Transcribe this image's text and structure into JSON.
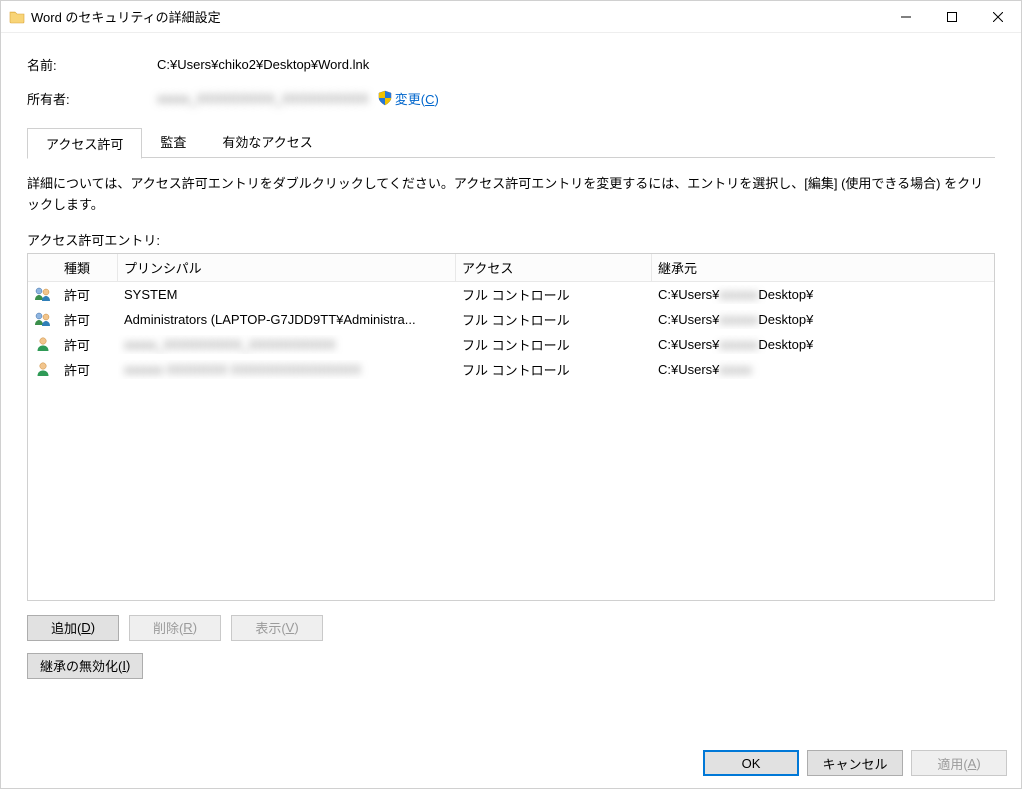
{
  "window": {
    "title": "Word のセキュリティの詳細設定"
  },
  "header": {
    "name_label": "名前:",
    "name_value": "C:¥Users¥chiko2¥Desktop¥Word.lnk",
    "owner_label": "所有者:",
    "owner_value": "xxxxx_XXXXXXXXX_XXXXXXXXXX",
    "change_link_prefix": "変更(",
    "change_link_hotkey": "C",
    "change_link_suffix": ")"
  },
  "tabs": {
    "items": [
      {
        "label": "アクセス許可",
        "active": true
      },
      {
        "label": "監査",
        "active": false
      },
      {
        "label": "有効なアクセス",
        "active": false
      }
    ]
  },
  "body": {
    "description": "詳細については、アクセス許可エントリをダブルクリックしてください。アクセス許可エントリを変更するには、エントリを選択し、[編集] (使用できる場合) をクリックします。",
    "entries_label": "アクセス許可エントリ:"
  },
  "table": {
    "columns": {
      "type": "種類",
      "principal": "プリンシパル",
      "access": "アクセス",
      "inherited": "継承元"
    },
    "rows": [
      {
        "icon": "group",
        "type": "許可",
        "principal": "SYSTEM",
        "principal_blurred": false,
        "access": "フル コントロール",
        "inherited": "C:¥Users¥",
        "inherited_mid_blur": "xxxxxx",
        "inherited_suffix": "Desktop¥"
      },
      {
        "icon": "group",
        "type": "許可",
        "principal": "Administrators (LAPTOP-G7JDD9TT¥Administra...",
        "principal_blurred": false,
        "access": "フル コントロール",
        "inherited": "C:¥Users¥",
        "inherited_mid_blur": "xxxxxx",
        "inherited_suffix": "Desktop¥"
      },
      {
        "icon": "user",
        "type": "許可",
        "principal": "xxxxx_XXXXXXXXX_XXXXXXXXXX",
        "principal_blurred": true,
        "access": "フル コントロール",
        "inherited": "C:¥Users¥",
        "inherited_mid_blur": "xxxxxx",
        "inherited_suffix": "Desktop¥"
      },
      {
        "icon": "user",
        "type": "許可",
        "principal": "xxxxxx XXXXXXX XXXXXXXXXXXXXXX",
        "principal_blurred": true,
        "access": "フル コントロール",
        "inherited": "C:¥Users¥",
        "inherited_mid_blur": "xxxxx",
        "inherited_suffix": ""
      }
    ]
  },
  "buttons": {
    "add_prefix": "追加(",
    "add_hotkey": "D",
    "add_suffix": ")",
    "remove_prefix": "削除(",
    "remove_hotkey": "R",
    "remove_suffix": ")",
    "view_prefix": "表示(",
    "view_hotkey": "V",
    "view_suffix": ")",
    "disable_inherit_prefix": "継承の無効化(",
    "disable_inherit_hotkey": "I",
    "disable_inherit_suffix": ")",
    "ok": "OK",
    "cancel": "キャンセル",
    "apply_prefix": "適用(",
    "apply_hotkey": "A",
    "apply_suffix": ")"
  }
}
